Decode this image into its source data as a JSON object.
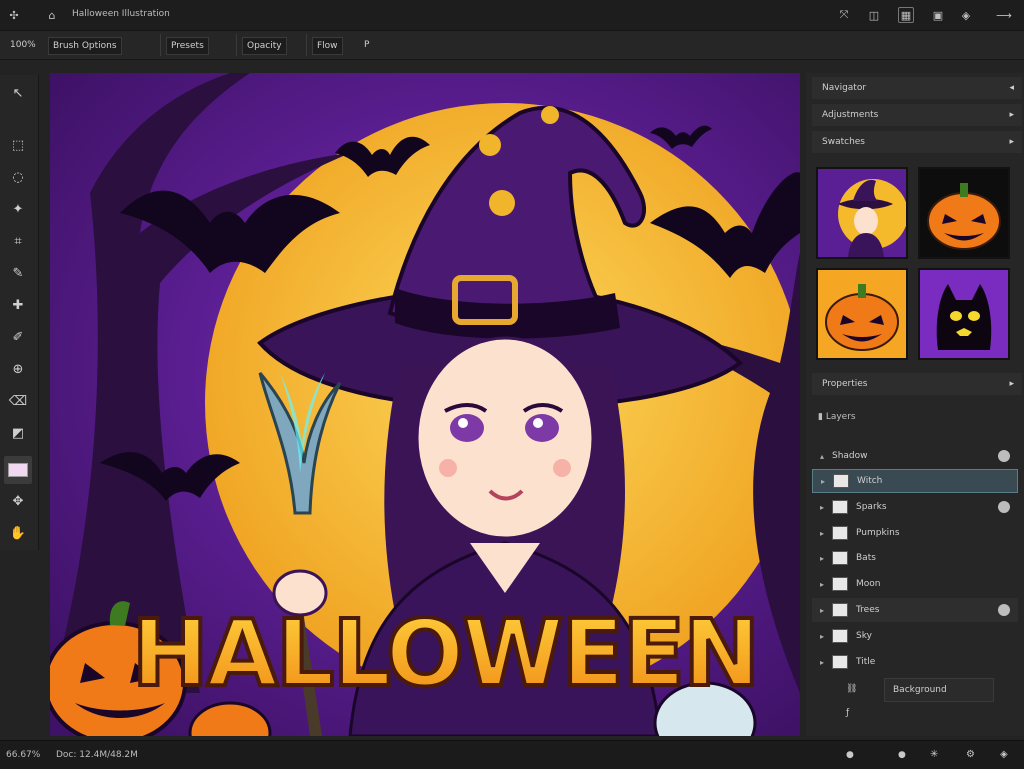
{
  "app": {
    "title": "Halloween Illustration"
  },
  "top_icons": [
    "move-icon",
    "layers-icon",
    "grid-icon",
    "screen-icon",
    "brush-icon",
    "view-icon",
    "minimize-icon"
  ],
  "options": {
    "brush_size": "100%",
    "mode_label": "Brush Options",
    "preset_label": "Presets",
    "opacity_label": "Opacity",
    "flow_label": "Flow",
    "pressure_label": "P"
  },
  "panels": {
    "navigator": "Navigator",
    "adjustments": "Adjustments",
    "swatches": "Swatches",
    "properties": "Properties",
    "layers": "Layers"
  },
  "canvas": {
    "title_text": "HALLOWEEN"
  },
  "layers": [
    {
      "name": "Shadow"
    },
    {
      "name": "Witch"
    },
    {
      "name": "Sparks"
    },
    {
      "name": "Pumpkins"
    },
    {
      "name": "Bats"
    },
    {
      "name": "Moon"
    },
    {
      "name": "Trees"
    },
    {
      "name": "Sky"
    },
    {
      "name": "Title"
    },
    {
      "name": "Background"
    }
  ],
  "status": {
    "zoom": "66.67%",
    "doc_info": "Doc: 12.4M/48.2M"
  },
  "colors": {
    "accent": "#5a7d8a",
    "moon": "#f5b92c",
    "sky": "#5a1f94"
  }
}
